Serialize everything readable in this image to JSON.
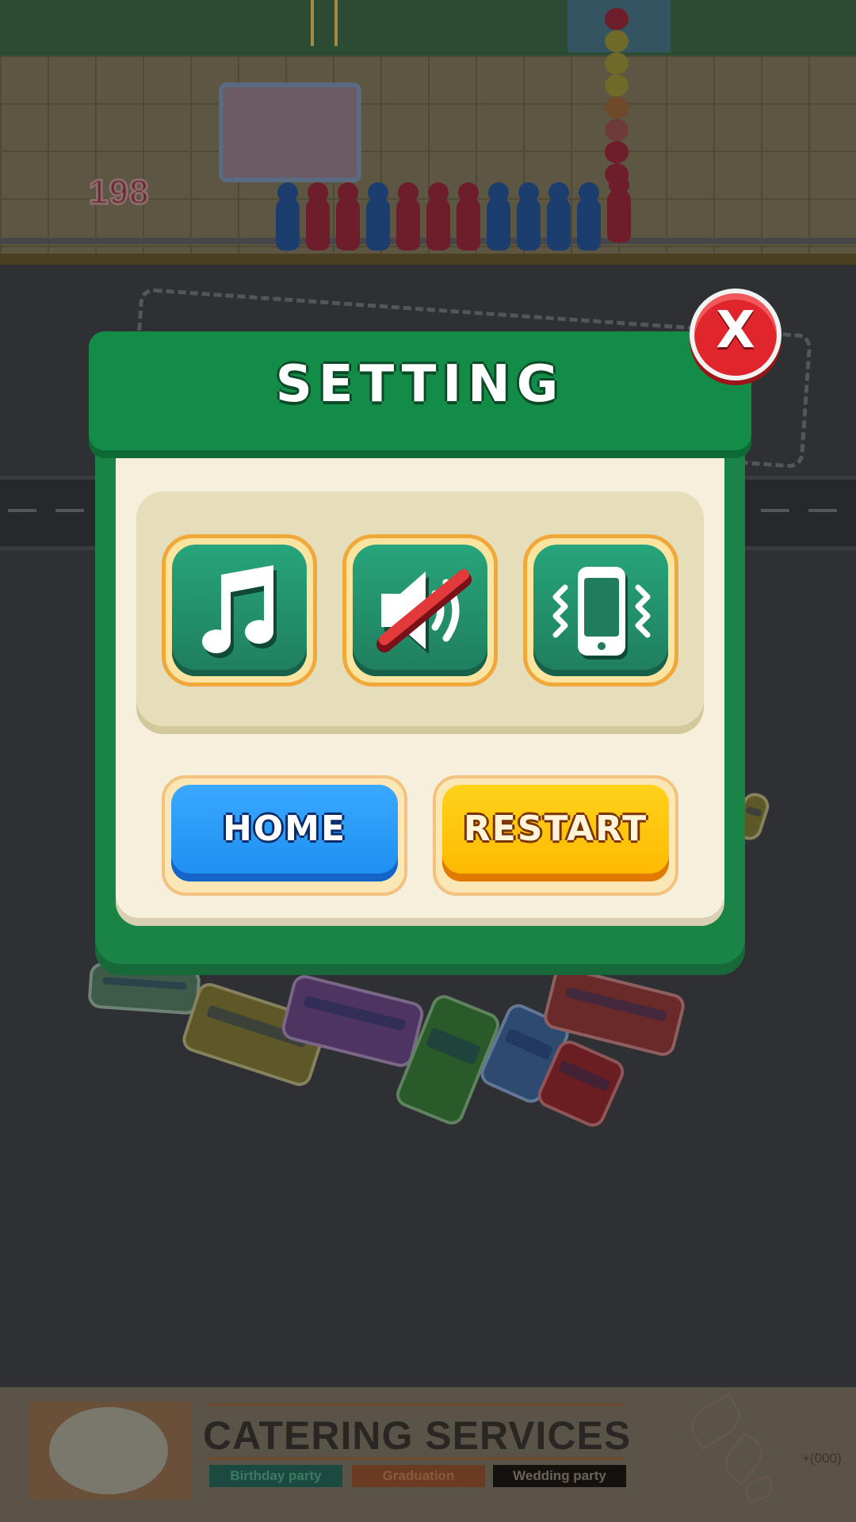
{
  "scene": {
    "counter": "198"
  },
  "dialog": {
    "title": "SETTING",
    "close_label": "X",
    "toggles": [
      {
        "name": "music",
        "icon": "music-note-icon",
        "state": "on"
      },
      {
        "name": "sound",
        "icon": "speaker-muted-icon",
        "state": "off"
      },
      {
        "name": "vibration",
        "icon": "phone-vibrate-icon",
        "state": "on"
      }
    ],
    "buttons": {
      "home_label": "HOME",
      "restart_label": "RESTART"
    }
  },
  "ad": {
    "title": "CATERING SERVICES",
    "tags": [
      "Birthday party",
      "Graduation",
      "Wedding party"
    ],
    "phone": "+(000)"
  },
  "colors": {
    "header_green": "#138c48",
    "toggle_teal": "#1f7d5e",
    "home_blue": "#1c8ef0",
    "restart_yellow": "#ffb800",
    "close_red": "#e0262c"
  }
}
